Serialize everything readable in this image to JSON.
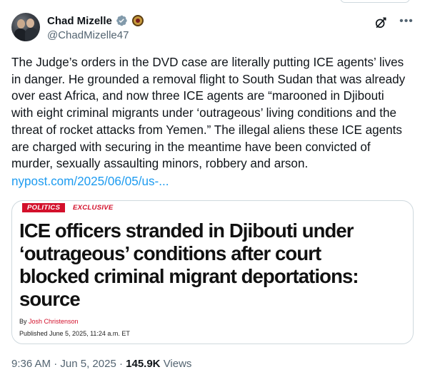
{
  "author": {
    "display_name": "Chad Mizelle",
    "handle": "@ChadMizelle47"
  },
  "icons": {
    "verified": "verified-badge-icon",
    "affiliation": "doj-seal-icon",
    "grok": "grok-icon",
    "more": "more-icon"
  },
  "tweet": {
    "text": "The Judge’s orders in the DVD case are literally putting ICE agents’ lives\nin danger. He grounded a removal flight to South Sudan that was already\nover east Africa, and now three ICE agents are “marooned in Djibouti\nwith eight criminal migrants under ‘outrageous’ living conditions and the\nthreat of rocket attacks from Yemen.” The illegal aliens these ICE agents\nare charged with securing in the meantime have been convicted of\nmurder, sexually assaulting minors, robbery and arson.",
    "link": "nypost.com/2025/06/05/us-..."
  },
  "card": {
    "tag_primary": "POLITICS",
    "tag_secondary": "EXCLUSIVE",
    "headline": "ICE officers stranded in Djibouti under\n‘outrageous’ conditions after court\nblocked criminal migrant deportations:\nsource",
    "byline_prefix": "By",
    "byline_author": "Josh Christenson",
    "published": "Published June 5, 2025, 11:24 a.m. ET"
  },
  "meta": {
    "time": "9:36 AM",
    "date": "Jun 5, 2025",
    "views_count": "145.9K",
    "views_label": "Views"
  },
  "colors": {
    "accent": "#1d9bf0",
    "nypost_red": "#d3102b",
    "secondary_text": "#536471"
  }
}
